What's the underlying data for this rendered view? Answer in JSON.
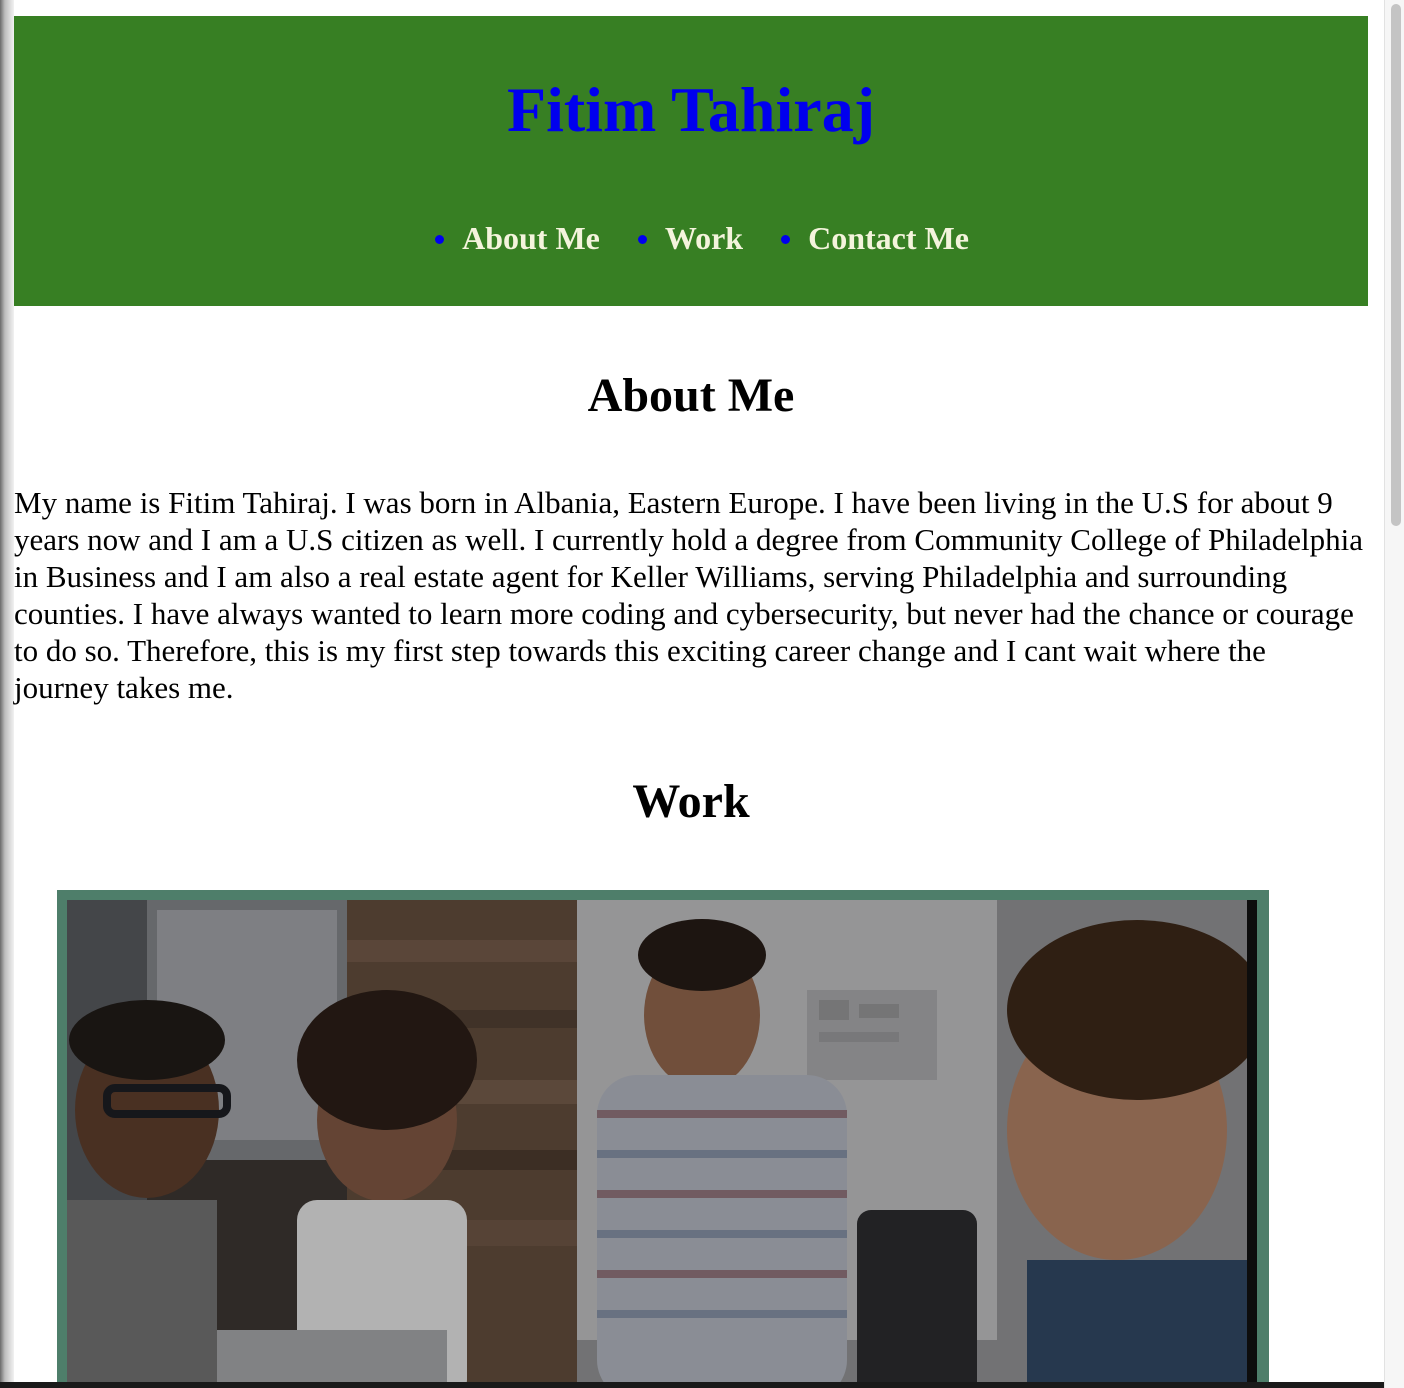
{
  "header": {
    "title": "Fitim Tahiraj",
    "nav": [
      {
        "label": "About Me"
      },
      {
        "label": "Work"
      },
      {
        "label": "Contact Me"
      }
    ]
  },
  "about": {
    "heading": "About Me",
    "text": "My name is Fitim Tahiraj. I was born in Albania, Eastern Europe. I have been living in the U.S for about 9 years now and I am a U.S citizen as well. I currently hold a degree from Community College of Philadelphia in Business and I am also a real estate agent for Keller Williams, serving Philadelphia and surrounding counties. I have always wanted to learn more coding and cybersecurity, but never had the chance or courage to do so. Therefore, this is my first step towards this exciting career change and I cant wait where the journey takes me."
  },
  "work": {
    "heading": "Work"
  },
  "colors": {
    "header_bg": "#377f23",
    "title": "#0000ee",
    "nav_text": "#f4f4dc",
    "frame": "#4e7e6a"
  }
}
